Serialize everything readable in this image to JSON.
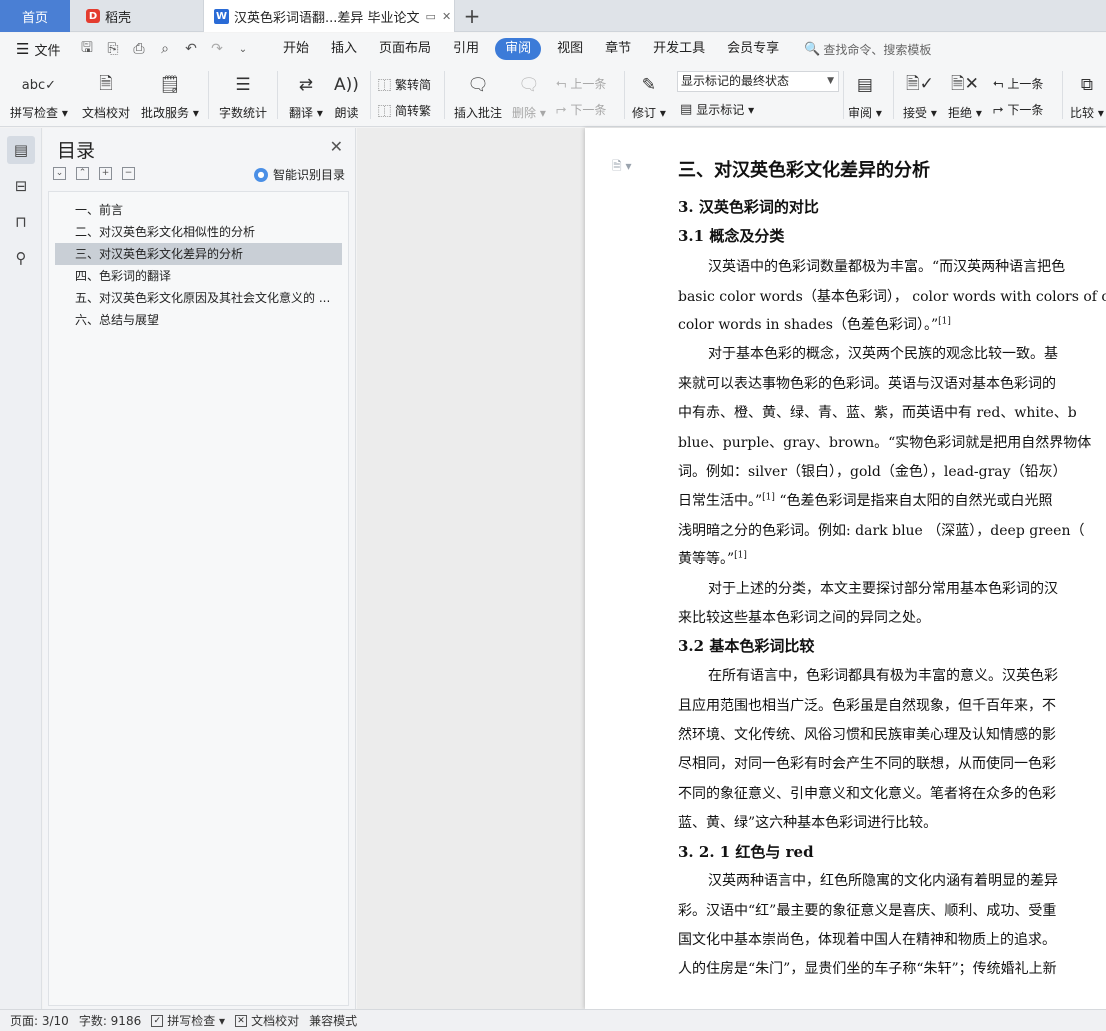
{
  "tabs": {
    "home": "首页",
    "daoke": "稻壳",
    "document": "汉英色彩词语翻...差异 毕业论文",
    "new_tab": "+"
  },
  "menubar": {
    "file": "文件",
    "tabs": [
      "开始",
      "插入",
      "页面布局",
      "引用",
      "审阅",
      "视图",
      "章节",
      "开发工具",
      "会员专享"
    ],
    "active_tab": "审阅",
    "search": "查找命令、搜索模板"
  },
  "ribbon": {
    "spell_check": "拼写检查",
    "doc_proofread": "文档校对",
    "correction_service": "批改服务",
    "word_count": "字数统计",
    "translate": "翻译",
    "read_aloud": "朗读",
    "trad_to_simp": "繁转简",
    "simp_to_trad": "简转繁",
    "insert_comment": "插入批注",
    "delete": "删除",
    "prev_comment": "上一条",
    "next_comment": "下一条",
    "track_changes": "修订",
    "markup_mode": "显示标记的最终状态",
    "show_markup": "显示标记",
    "review_pane": "审阅",
    "accept": "接受",
    "reject": "拒绝",
    "prev_change": "上一条",
    "next_change": "下一条",
    "compare": "比较"
  },
  "nav": {
    "title": "目录",
    "smart_toc": "智能识别目录",
    "items": [
      "一、前言",
      "二、对汉英色彩文化相似性的分析",
      "三、对汉英色彩文化差异的分析",
      "四、色彩词的翻译",
      "五、对汉英色彩文化原因及其社会文化意义的 ...",
      "六、总结与展望"
    ],
    "selected_index": 2
  },
  "document": {
    "lines": [
      "三、对汉英色彩文化差异的分析",
      "3. 汉英色彩词的对比",
      "3.1  概念及分类",
      "汉英语中的色彩词数量都极为丰富。“而汉英两种语言把色",
      "basic color words（基本色彩词）， color words with colors of ob",
      "color words in shades（色差色彩词）。”",
      "对于基本色彩的概念，汉英两个民族的观念比较一致。基",
      "来就可以表达事物色彩的色彩词。英语与汉语对基本色彩词的",
      "中有赤、橙、黄、绿、青、蓝、紫，而英语中有 red、white、b",
      "blue、purple、gray、brown。“实物色彩词就是把用自然界物体",
      "词。例如：silver（银白），gold（金色），lead-gray（铅灰）",
      "日常生活中。”",
      "“色差色彩词是指来自太阳的自然光或白光照",
      "浅明暗之分的色彩词。例如: dark blue （深蓝），deep green（",
      "黄等等。”",
      "对于上述的分类，本文主要探讨部分常用基本色彩词的汉",
      "来比较这些基本色彩词之间的异同之处。",
      "3.2  基本色彩词比较",
      "在所有语言中，色彩词都具有极为丰富的意义。汉英色彩",
      "且应用范围也相当广泛。色彩虽是自然现象，但千百年来，不",
      "然环境、文化传统、风俗习惯和民族审美心理及认知情感的影",
      "尽相同，对同一色彩有时会产生不同的联想，从而使同一色彩",
      "不同的象征意义、引申意义和文化意义。笔者将在众多的色彩",
      "蓝、黄、绿”这六种基本色彩词进行比较。",
      "3. 2. 1 红色与 red",
      "汉英两种语言中，红色所隐寓的文化内涵有着明显的差异",
      "彩。汉语中“红”最主要的象征意义是喜庆、顺利、成功、受重",
      "国文化中基本崇尚色，体现着中国人在精神和物质上的追求。",
      "人的住房是“朱门”，显贵们坐的车子称“朱轩”；传统婚礼上新"
    ],
    "citation": "[1]"
  },
  "status": {
    "page": "页面: 3/10",
    "words": "字数: 9186",
    "spell_check": "拼写检查",
    "proofread": "文档校对",
    "compat_mode": "兼容模式"
  }
}
